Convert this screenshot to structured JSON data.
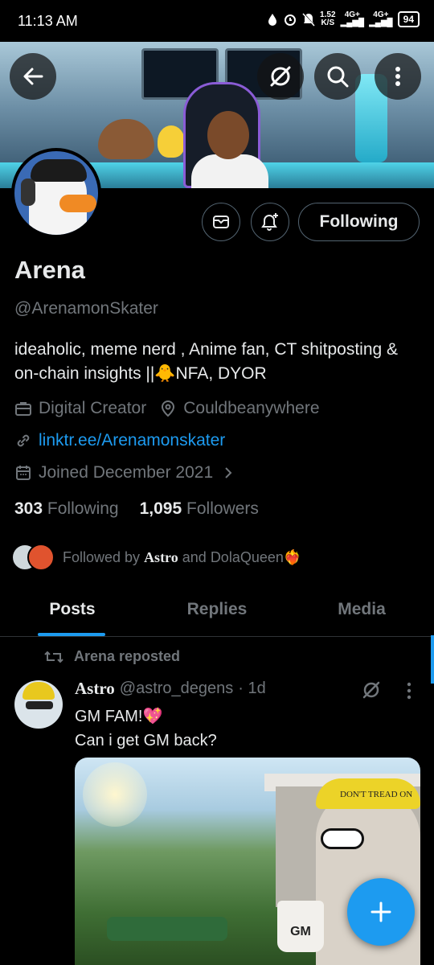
{
  "status": {
    "time": "11:13 AM",
    "net_speed": "1.52",
    "net_unit": "K/S",
    "signal1": "4G+",
    "signal2": "4G+",
    "battery": "94"
  },
  "header": {
    "icons": [
      "back-arrow-icon",
      "grok-icon",
      "search-icon",
      "more-vertical-icon"
    ]
  },
  "profile": {
    "name": "Arena",
    "handle": "@ArenamonSkater",
    "bio": "ideaholic, meme nerd , Anime fan, CT shitposting & on-chain insights ||🐥NFA, DYOR",
    "category": "Digital Creator",
    "location": "Couldbeanywhere",
    "link": "linktr.ee/Arenamonskater",
    "joined": "Joined December 2021",
    "following_count": "303",
    "following_label": "Following",
    "followers_count": "1,095",
    "followers_label": "Followers",
    "followed_by_prefix": "Followed by",
    "followed_by_name1": "Astro",
    "followed_by_and": "and",
    "followed_by_name2": "DolaQueen❤️‍🔥"
  },
  "actions": {
    "following_button": "Following",
    "icons": [
      "message-icon",
      "notification-bell-icon"
    ]
  },
  "tabs": [
    {
      "label": "Posts",
      "active": true
    },
    {
      "label": "Replies",
      "active": false
    },
    {
      "label": "Media",
      "active": false
    }
  ],
  "post": {
    "repost_label": "Arena reposted",
    "author": "Astro",
    "author_handle": "@astro_degens",
    "time": "· 1d",
    "line1": "GM FAM!💖",
    "line2": "Can i get GM back?",
    "image_texts": {
      "bandana": "DON'T TREAD ON",
      "mug": "GM"
    }
  },
  "colors": {
    "accent": "#1d9bf0",
    "text": "#e7e9ea",
    "muted": "#71767b",
    "border": "#536471"
  }
}
